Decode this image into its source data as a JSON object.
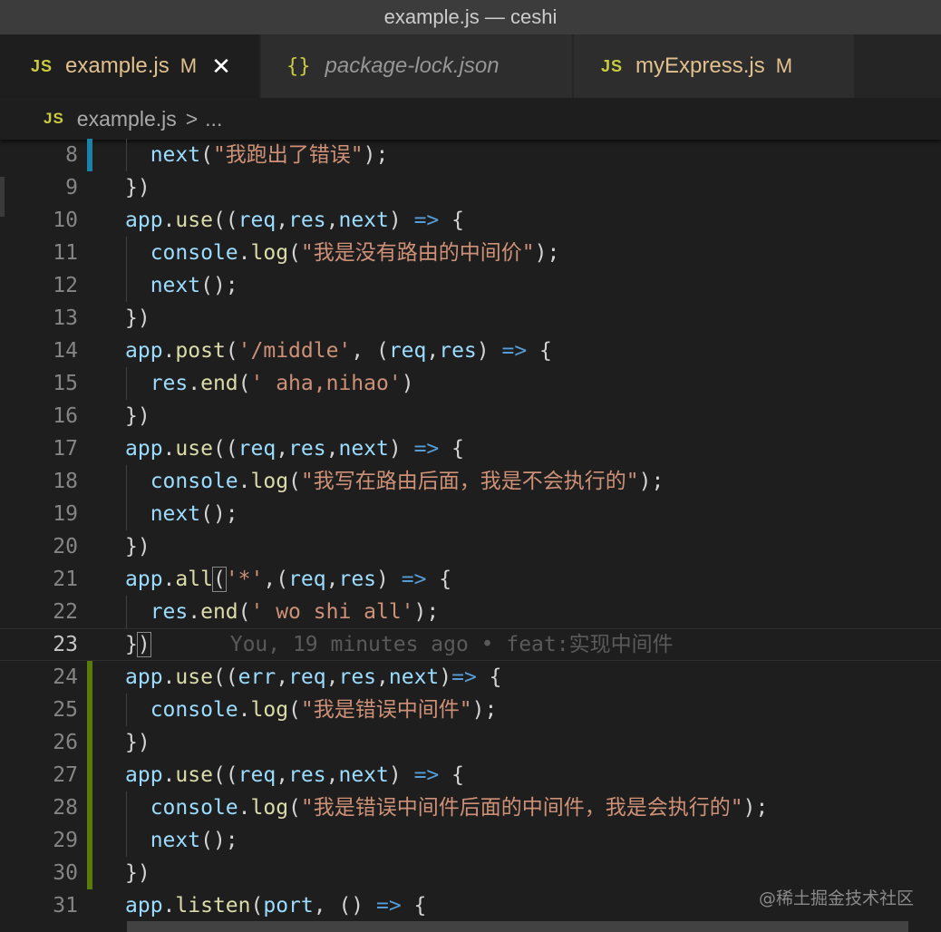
{
  "window": {
    "title": "example.js — ceshi"
  },
  "tabs": [
    {
      "icon": "JS",
      "label": "example.js",
      "modified": "M",
      "active": true
    },
    {
      "icon": "{}",
      "label": "package-lock.json",
      "active": false
    },
    {
      "icon": "JS",
      "label": "myExpress.js",
      "modified": "M",
      "active": false
    }
  ],
  "breadcrumb": {
    "icon": "JS",
    "file": "example.js",
    "separator": ">",
    "rest": "..."
  },
  "editor": {
    "lines": [
      {
        "n": "8",
        "text": "    next(\"我跑出了错误\");"
      },
      {
        "n": "9",
        "text": "  })"
      },
      {
        "n": "10",
        "text": "  app.use((req,res,next) => {"
      },
      {
        "n": "11",
        "text": "    console.log(\"我是没有路由的中间价\");"
      },
      {
        "n": "12",
        "text": "    next();"
      },
      {
        "n": "13",
        "text": "  })"
      },
      {
        "n": "14",
        "text": "  app.post('/middle', (req,res) => {"
      },
      {
        "n": "15",
        "text": "    res.end(' aha,nihao')"
      },
      {
        "n": "16",
        "text": "  })"
      },
      {
        "n": "17",
        "text": "  app.use((req,res,next) => {"
      },
      {
        "n": "18",
        "text": "    console.log(\"我写在路由后面，我是不会执行的\");"
      },
      {
        "n": "19",
        "text": "    next();"
      },
      {
        "n": "20",
        "text": "  })"
      },
      {
        "n": "21",
        "text": "  app.all('*',(req,res) => {"
      },
      {
        "n": "22",
        "text": "    res.end(' wo shi all');"
      },
      {
        "n": "23",
        "text": "  })"
      },
      {
        "n": "24",
        "text": "  app.use((err,req,res,next)=> {"
      },
      {
        "n": "25",
        "text": "    console.log(\"我是错误中间件\");"
      },
      {
        "n": "26",
        "text": "  })"
      },
      {
        "n": "27",
        "text": "  app.use((req,res,next) => {"
      },
      {
        "n": "28",
        "text": "    console.log(\"我是错误中间件后面的中间件，我是会执行的\");"
      },
      {
        "n": "29",
        "text": "    next();"
      },
      {
        "n": "30",
        "text": "  })"
      },
      {
        "n": "31",
        "text": "  app.listen(port, () => {"
      }
    ],
    "blame": "You, 19 minutes ago • feat:实现中间件"
  },
  "watermark": "@稀土掘金技术社区",
  "colors": {
    "function": "#dcdcaa",
    "variable": "#9cdcfe",
    "string": "#ce9178",
    "keyword_arrow": "#569cd6",
    "gutter_modified": "#1b81a8",
    "gutter_added": "#587c0c"
  }
}
